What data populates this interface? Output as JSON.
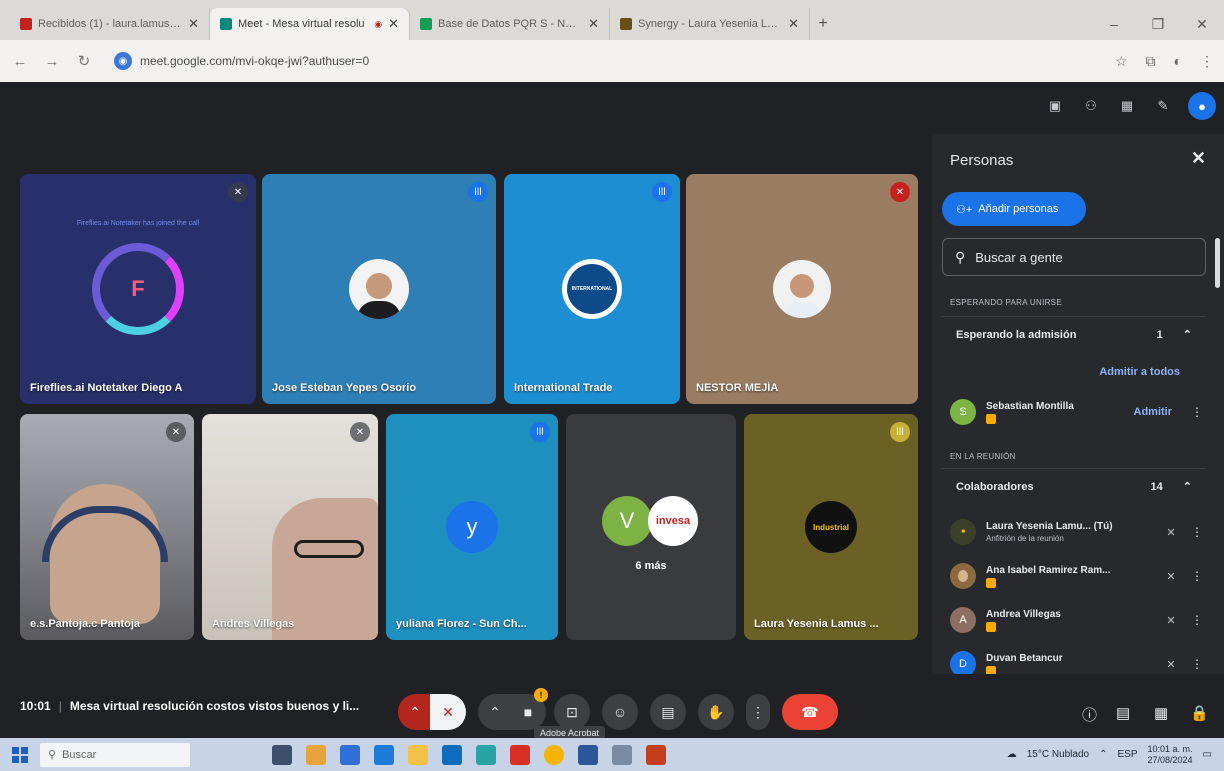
{
  "browser": {
    "tabs": [
      {
        "label": "Recibidos (1) - laura.lamus@v",
        "favicon_color": "#c5221f",
        "active": false
      },
      {
        "label": "Meet - Mesa virtual resolu",
        "favicon_color": "#00897b",
        "active": true
      },
      {
        "label": "Base de Datos PQR S - Nueva",
        "favicon_color": "#0f9d58",
        "active": false
      },
      {
        "label": "Synergy - Laura Yesenia Lamu",
        "favicon_color": "#6b4e16",
        "active": false
      }
    ],
    "new_tab": "+",
    "address": "meet.google.com/mvi-okqe-jwi?authuser=0"
  },
  "tiles": [
    {
      "name": "Fireflies.ai Notetaker Diego A",
      "caption": "Fireflies.ai Notetaker has joined the call",
      "type": "fireflies",
      "bg": "#27306b"
    },
    {
      "name": "Jose Esteban Yepes Osorio",
      "type": "photo",
      "bg": "#2e7fb5",
      "speaking": true
    },
    {
      "name": "International Trade",
      "type": "logo",
      "bg": "#1d8ed1",
      "logo_text": "INTERNATIONAL",
      "speaking": true
    },
    {
      "name": "NESTOR MEJÍA",
      "type": "photo",
      "bg": "#9a7c62"
    },
    {
      "name": "e.s.Pantoja.c Pantoja",
      "type": "video",
      "bg": "#8d9098"
    },
    {
      "name": "Andres Villegas",
      "type": "video",
      "bg": "#b8b3ac"
    },
    {
      "name": "yuliana Florez - Sun Ch...",
      "type": "letter",
      "letter": "y",
      "bg": "#1e90c0",
      "avatar_color": "#1a73e8",
      "speaking": true
    },
    {
      "name": "",
      "type": "more",
      "bg": "#3a3b3e",
      "letter": "V",
      "logo_text": "invesa",
      "more_label": "6 más"
    },
    {
      "name": "Laura Yesenia Lamus ...",
      "type": "logo2",
      "bg": "#6b6124",
      "logo_text": "Industrial",
      "speaking": true
    }
  ],
  "panel": {
    "title": "Personas",
    "add_people": "Añadir personas",
    "search_placeholder": "Buscar a gente",
    "waiting_section": "ESPERANDO PARA UNIRSE",
    "waiting_group": {
      "label": "Esperando la admisión",
      "count": "1"
    },
    "admit_all": "Admitir a todos",
    "waiting_people": [
      {
        "name": "Sebastian Montilla",
        "initial": "S",
        "color": "#7cb342",
        "action": "Admitir"
      }
    ],
    "meeting_section": "EN LA REUNIÓN",
    "collab_group": {
      "label": "Colaboradores",
      "count": "14"
    },
    "people": [
      {
        "name": "Laura Yesenia Lamu... (Tú)",
        "sub": "Anfitrión de la reunión",
        "initial": "",
        "color": "#3c3f2a",
        "type": "logo"
      },
      {
        "name": "Ana Isabel Ramirez Ram...",
        "sub": "",
        "initial": "",
        "color": "#8a6a3e",
        "type": "photo"
      },
      {
        "name": "Andrea Villegas",
        "sub": "",
        "initial": "A",
        "color": "#8d6e63",
        "type": "letter"
      },
      {
        "name": "Duvan Betancur",
        "sub": "",
        "initial": "D",
        "color": "#1a73e8",
        "type": "letter"
      }
    ]
  },
  "bottom": {
    "time": "10:01",
    "title": "Mesa virtual resolución costos vistos buenos y li...",
    "tooltip": "Adobe Acrobat",
    "present_badge": "!"
  },
  "taskbar": {
    "search": "Buscar",
    "weather": "15°C Nublado",
    "lang": "ESP",
    "time": "10:01 a. m.",
    "date": "27/08/2024"
  }
}
